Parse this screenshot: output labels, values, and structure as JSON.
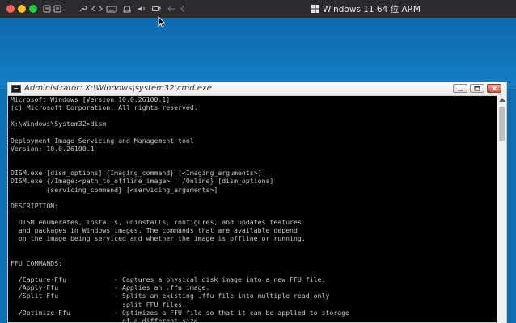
{
  "toolbar": {
    "vm_name": "Windows 11 64 位 ARM",
    "colors": {
      "close": "#fe5f57",
      "minimize": "#febc2e",
      "zoom": "#28c840"
    }
  },
  "cmd_window": {
    "title": "Administrator: X:\\Windows\\system32\\cmd.exe",
    "lines": [
      "Microsoft Windows [Version 10.0.26100.1]",
      "(c) Microsoft Corporation. All rights reserved.",
      "",
      "X:\\Windows\\System32>dism",
      "",
      "Deployment Image Servicing and Management tool",
      "Version: 10.0.26100.1",
      "",
      "",
      "DISM.exe [dism_options] {Imaging_command} [<Imaging_arguments>]",
      "DISM.exe {/Image:<path_to_offline_image> | /Online} [dism_options]",
      "         {servicing_command} [<servicing_arguments>]",
      "",
      "DESCRIPTION:",
      "",
      "  DISM enumerates, installs, uninstalls, configures, and updates features",
      "  and packages in Windows images. The commands that are available depend",
      "  on the image being serviced and whether the image is offline or running.",
      "",
      "",
      "FFU COMMANDS:",
      "",
      "  /Capture-Ffu            - Captures a physical disk image into a new FFU file.",
      "  /Apply-Ffu              - Applies an .ffu image.",
      "  /Split-Ffu              - Splits an existing .ffu file into multiple read-only",
      "                            split FFU files.",
      "  /Optimize-Ffu           - Optimizes a FFU file so that it can be applied to storage",
      "                            of a different size."
    ]
  }
}
